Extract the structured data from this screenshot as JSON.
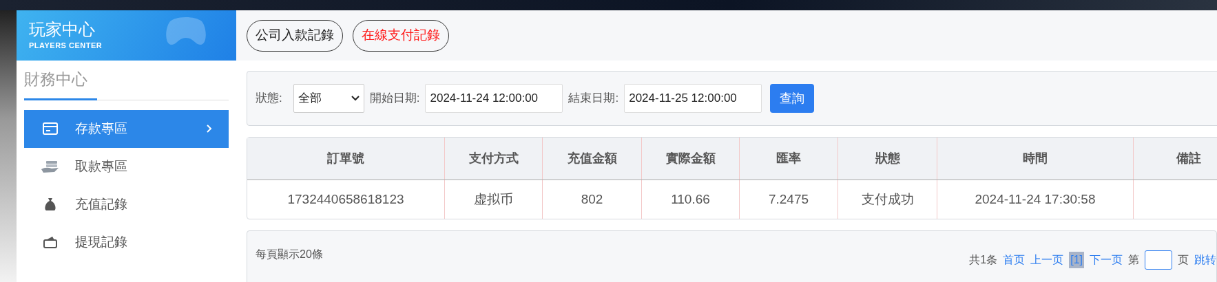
{
  "brand": {
    "title": "玩家中心",
    "subtitle": "PLAYERS CENTER"
  },
  "top_tabs": [
    {
      "label": "公司入款記錄",
      "selected": false
    },
    {
      "label": "在線支付記錄",
      "selected": true
    }
  ],
  "sidebar": {
    "heading": "財務中心",
    "items": [
      {
        "label": "存款專區",
        "kind": "card",
        "selected": true,
        "expandable": true
      },
      {
        "label": "取款專區",
        "kind": "hand",
        "selected": false,
        "expandable": false
      },
      {
        "label": "充值記錄",
        "kind": "bag",
        "selected": false,
        "expandable": false
      },
      {
        "label": "提現記錄",
        "kind": "wallet",
        "selected": false,
        "expandable": false
      }
    ]
  },
  "filters": {
    "status_label": "狀態:",
    "status_value": "全部",
    "start_label": "開始日期:",
    "start_value": "2024-11-24 12:00:00",
    "end_label": "結束日期:",
    "end_value": "2024-11-25 12:00:00",
    "query_button": "查詢"
  },
  "table": {
    "columns": [
      "訂單號",
      "支付方式",
      "充值金額",
      "實際金額",
      "匯率",
      "狀態",
      "時間",
      "備註"
    ],
    "rows": [
      [
        "1732440658618123",
        "虚拟币",
        "802",
        "110.66",
        "7.2475",
        "支付成功",
        "2024-11-24 17:30:58",
        ""
      ]
    ]
  },
  "pagination": {
    "per_page": "每頁顯示20條",
    "total": "共1条",
    "first": "首页",
    "prev": "上一页",
    "current": "[1]",
    "next": "下一页",
    "goto_prefix": "第",
    "goto_suffix": "页",
    "goto_button": "跳转"
  }
}
